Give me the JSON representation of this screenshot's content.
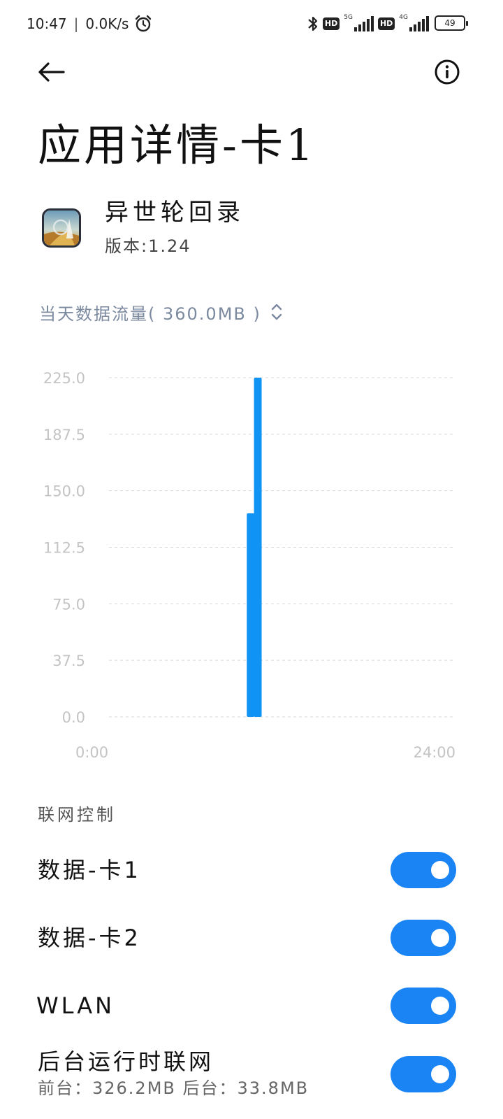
{
  "status_bar": {
    "time": "10:47",
    "separator": "|",
    "net_speed": "0.0K/s",
    "net_5g": "5G",
    "net_4g": "4G",
    "hd": "HD",
    "battery": "49"
  },
  "header": {
    "title": "应用详情-卡1"
  },
  "app": {
    "name": "异世轮回录",
    "version": "版本:1.24"
  },
  "usage": {
    "label": "当天数据流量( 360.0MB )"
  },
  "chart_data": {
    "type": "bar",
    "y_ticks": [
      "225.0",
      "187.5",
      "150.0",
      "112.5",
      "75.0",
      "37.5",
      "0.0"
    ],
    "ylim": [
      0,
      225
    ],
    "x_start_label": "0:00",
    "x_end_label": "24:00",
    "x": [
      9.85,
      10.35
    ],
    "values": [
      135,
      225
    ],
    "color": "#0f93f5",
    "grid": true
  },
  "network": {
    "section_title": "联网控制",
    "rows": [
      {
        "label": "数据-卡1",
        "enabled": true
      },
      {
        "label": "数据-卡2",
        "enabled": true
      },
      {
        "label": "WLAN",
        "enabled": true
      },
      {
        "label": "后台运行时联网",
        "sub": "前台：326.2MB  后台：33.8MB",
        "enabled": true
      }
    ]
  },
  "colors": {
    "accent": "#1a84f5",
    "bar": "#0f93f5",
    "muted_text": "#7c8aa0"
  }
}
